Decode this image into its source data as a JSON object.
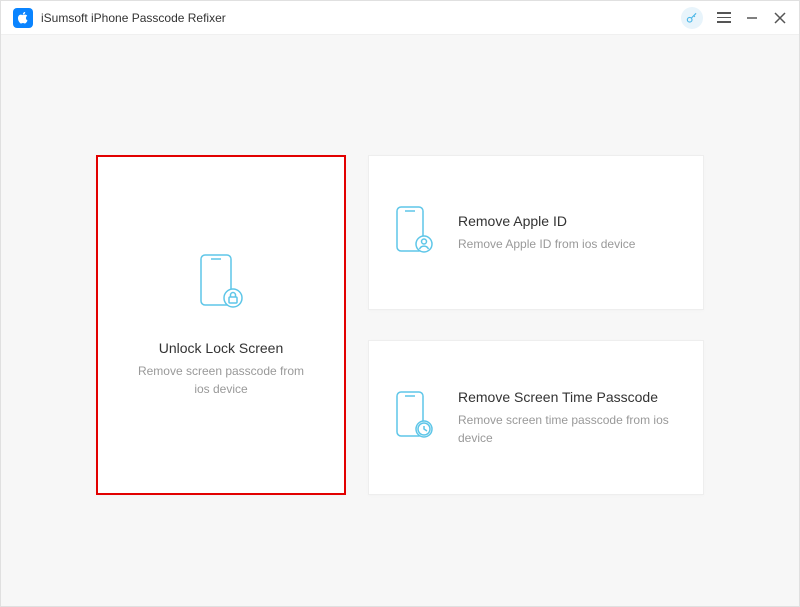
{
  "app": {
    "title": "iSumsoft iPhone Passcode Refixer"
  },
  "cards": {
    "unlock": {
      "title": "Unlock Lock Screen",
      "desc": "Remove screen passcode from ios device"
    },
    "appleId": {
      "title": "Remove Apple ID",
      "desc": "Remove Apple ID from ios device"
    },
    "screenTime": {
      "title": "Remove Screen Time Passcode",
      "desc": "Remove screen time passcode from ios device"
    }
  }
}
